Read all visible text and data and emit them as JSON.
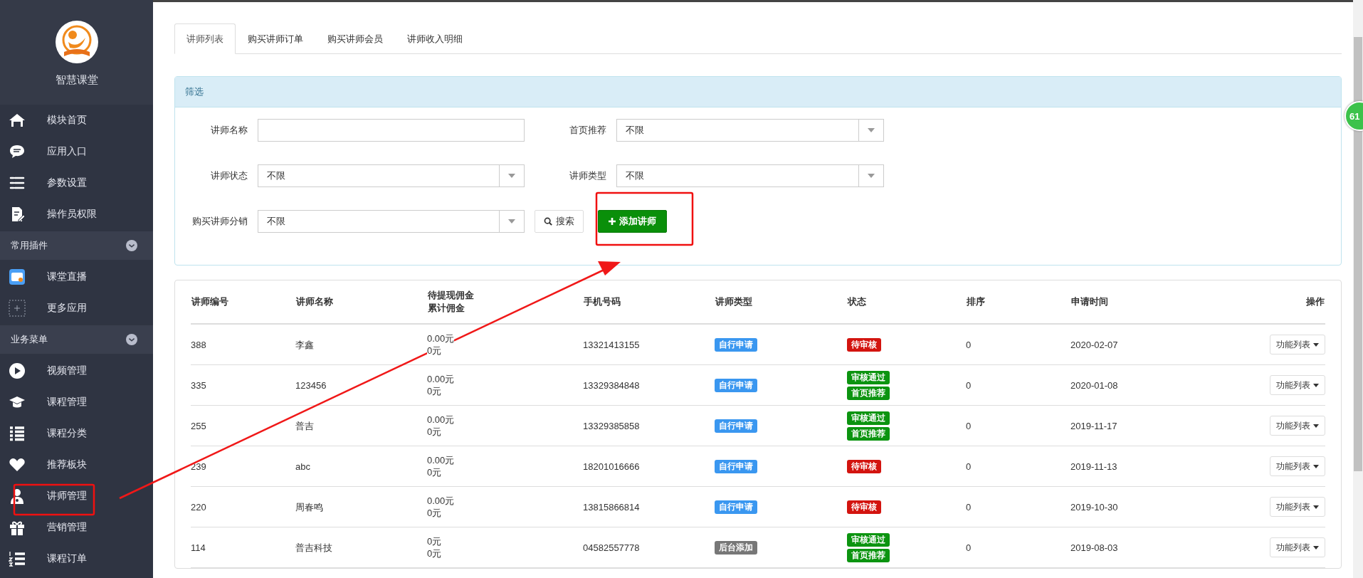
{
  "sidebar": {
    "title": "智慧课堂",
    "items": [
      {
        "kind": "item",
        "label": "模块首页"
      },
      {
        "kind": "item",
        "label": "应用入口"
      },
      {
        "kind": "item",
        "label": "参数设置"
      },
      {
        "kind": "item",
        "label": "操作员权限"
      },
      {
        "kind": "section",
        "label": "常用插件",
        "expanded": true
      },
      {
        "kind": "item",
        "label": "课堂直播"
      },
      {
        "kind": "item",
        "label": "更多应用"
      },
      {
        "kind": "section",
        "label": "业务菜单",
        "expanded": true
      },
      {
        "kind": "item",
        "label": "视频管理"
      },
      {
        "kind": "item",
        "label": "课程管理"
      },
      {
        "kind": "item",
        "label": "课程分类"
      },
      {
        "kind": "item",
        "label": "推荐板块"
      },
      {
        "kind": "item",
        "label": "讲师管理"
      },
      {
        "kind": "item",
        "label": "营销管理"
      },
      {
        "kind": "item",
        "label": "课程订单"
      }
    ]
  },
  "tabs": [
    {
      "label": "讲师列表",
      "selected": true
    },
    {
      "label": "购买讲师订单",
      "selected": false
    },
    {
      "label": "购买讲师会员",
      "selected": false
    },
    {
      "label": "讲师收入明细",
      "selected": false
    }
  ],
  "filter": {
    "title": "筛选",
    "fields": [
      {
        "kind": "text",
        "label": "讲师名称"
      },
      {
        "kind": "select",
        "label": "首页推荐",
        "value": "不限"
      },
      {
        "kind": "select",
        "label": "讲师状态",
        "value": "不限"
      },
      {
        "kind": "select",
        "label": "讲师类型",
        "value": "不限"
      },
      {
        "kind": "select",
        "label": "购买讲师分销",
        "value": "不限"
      }
    ],
    "search_button": "搜索",
    "add_button": "添加讲师"
  },
  "table": {
    "columns": [
      [
        "讲师编号"
      ],
      [
        "讲师名称"
      ],
      [
        "待提现佣金",
        "累计佣金"
      ],
      [
        "手机号码"
      ],
      [
        "讲师类型"
      ],
      [
        "状态"
      ],
      [
        "排序"
      ],
      [
        "申请时间"
      ],
      [
        "操作"
      ]
    ],
    "rows": [
      {
        "id": "388",
        "name": "李鑫",
        "pending": "0.00元",
        "total": "0元",
        "phone": "13321413155",
        "type": {
          "label": "自行申请",
          "color": "#3a97f0"
        },
        "status": [
          {
            "label": "待审核",
            "color": "#d3140f"
          }
        ],
        "sort": "0",
        "date": "2020-02-07",
        "action": "功能列表"
      },
      {
        "id": "335",
        "name": "123456",
        "pending": "0.00元",
        "total": "0元",
        "phone": "13329384848",
        "type": {
          "label": "自行申请",
          "color": "#3a97f0"
        },
        "status": [
          {
            "label": "审核通过",
            "color": "#0c9410"
          },
          {
            "label": "首页推荐",
            "color": "#0c9410"
          }
        ],
        "sort": "0",
        "date": "2020-01-08",
        "action": "功能列表"
      },
      {
        "id": "255",
        "name": "普吉",
        "pending": "0.00元",
        "total": "0元",
        "phone": "13329385858",
        "type": {
          "label": "自行申请",
          "color": "#3a97f0"
        },
        "status": [
          {
            "label": "审核通过",
            "color": "#0c9410"
          },
          {
            "label": "首页推荐",
            "color": "#0c9410"
          }
        ],
        "sort": "0",
        "date": "2019-11-17",
        "action": "功能列表"
      },
      {
        "id": "239",
        "name": "abc",
        "pending": "0.00元",
        "total": "0元",
        "phone": "18201016666",
        "type": {
          "label": "自行申请",
          "color": "#3a97f0"
        },
        "status": [
          {
            "label": "待审核",
            "color": "#d3140f"
          }
        ],
        "sort": "0",
        "date": "2019-11-13",
        "action": "功能列表"
      },
      {
        "id": "220",
        "name": "周春鸣",
        "pending": "0.00元",
        "total": "0元",
        "phone": "13815866814",
        "type": {
          "label": "自行申请",
          "color": "#3a97f0"
        },
        "status": [
          {
            "label": "待审核",
            "color": "#d3140f"
          }
        ],
        "sort": "0",
        "date": "2019-10-30",
        "action": "功能列表"
      },
      {
        "id": "114",
        "name": "普吉科技",
        "pending": "0元",
        "total": "0元",
        "phone": "04582557778",
        "type": {
          "label": "后台添加",
          "color": "#777777"
        },
        "status": [
          {
            "label": "审核通过",
            "color": "#0c9410"
          },
          {
            "label": "首页推荐",
            "color": "#0c9410"
          }
        ],
        "sort": "0",
        "date": "2019-08-03",
        "action": "功能列表"
      }
    ]
  },
  "floating_badge": "61"
}
